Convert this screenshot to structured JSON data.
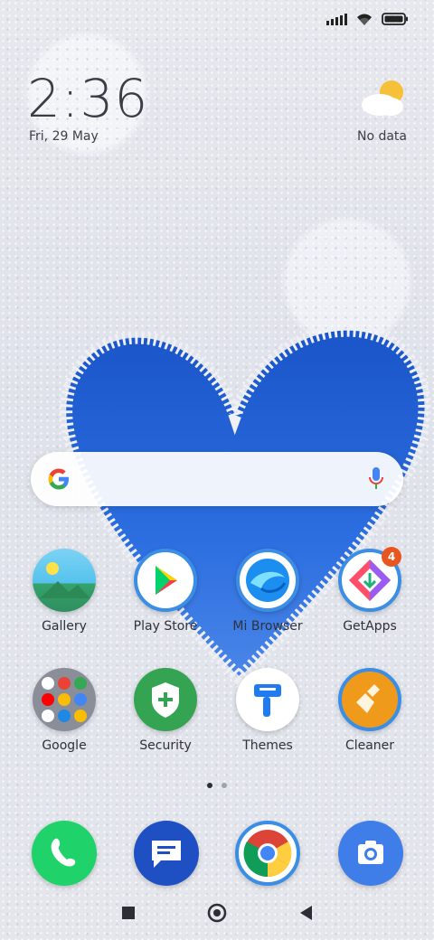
{
  "clock": {
    "time": "2:36",
    "date": "Fri, 29 May"
  },
  "weather": {
    "text": "No data",
    "icon": "partly-cloudy-icon"
  },
  "search": {
    "logo": "google-g-icon",
    "mic": "mic-icon"
  },
  "apps_row1": [
    {
      "label": "Gallery",
      "icon": "gallery-icon"
    },
    {
      "label": "Play Store",
      "icon": "play-store-icon"
    },
    {
      "label": "Mi Browser",
      "icon": "mi-browser-icon"
    },
    {
      "label": "GetApps",
      "icon": "getapps-icon",
      "badge": "4"
    }
  ],
  "apps_row2": [
    {
      "label": "Google",
      "icon": "google-folder-icon"
    },
    {
      "label": "Security",
      "icon": "security-icon"
    },
    {
      "label": "Themes",
      "icon": "themes-icon"
    },
    {
      "label": "Cleaner",
      "icon": "cleaner-icon"
    }
  ],
  "dock": [
    {
      "name": "phone",
      "icon": "phone-icon"
    },
    {
      "name": "messages",
      "icon": "messages-icon"
    },
    {
      "name": "chrome",
      "icon": "chrome-icon"
    },
    {
      "name": "camera",
      "icon": "camera-icon"
    }
  ],
  "nav": {
    "recents": "square-icon",
    "home": "circle-icon",
    "back": "triangle-back-icon"
  },
  "colors": {
    "heart_blue": "#1f63d8",
    "badge": "#e8551f",
    "text": "#2f3239"
  }
}
